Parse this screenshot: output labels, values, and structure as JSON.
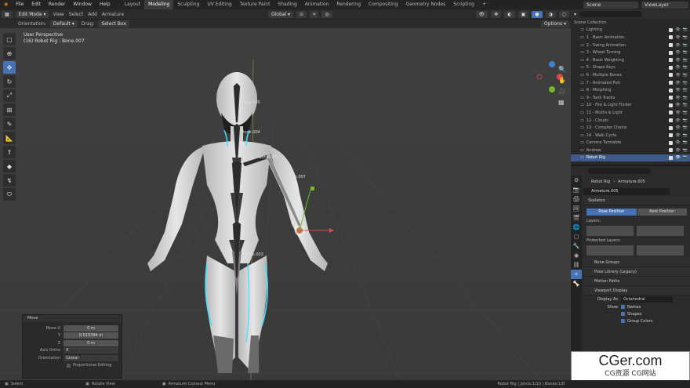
{
  "top_menu": [
    "File",
    "Edit",
    "Render",
    "Window",
    "Help"
  ],
  "workspaces": [
    "Layout",
    "Modeling",
    "Sculpting",
    "UV Editing",
    "Texture Paint",
    "Shading",
    "Animation",
    "Rendering",
    "Compositing",
    "Geometry Nodes",
    "Scripting"
  ],
  "active_workspace": "Modeling",
  "scene_name": "Scene",
  "view_layer": "ViewLayer",
  "header": {
    "mode": "Edit Mode",
    "view": "View",
    "select": "Select",
    "add": "Add",
    "armature": "Armature",
    "transform": "Global",
    "options": "Options"
  },
  "header3": {
    "orientation_label": "Orientation:",
    "orientation": "Default",
    "drag_label": "Drag:",
    "drag": "Select Box"
  },
  "viewport": {
    "view_name": "User Perspective",
    "object_info": "(16) Robot Rig : Bone.007"
  },
  "bone_labels": [
    "Bone.005",
    "Bone.004",
    "Bone.006",
    "Bone.007",
    "Bone.003"
  ],
  "move_panel": {
    "title": "Move",
    "move_x_label": "Move X",
    "x": "0 m",
    "y_label": "Y",
    "y": "0.010394 m",
    "z_label": "Z",
    "z": "0 m",
    "axis_ortho_label": "Axis Ortho",
    "axis_ortho": "X",
    "orientation_label": "Orientation",
    "orientation": "Global",
    "proportional": "Proportional Editing"
  },
  "outliner": {
    "root": "Scene Collection",
    "items": [
      {
        "label": "Lighting"
      },
      {
        "label": "1 - Basic Animation"
      },
      {
        "label": "2 - Swing Animation"
      },
      {
        "label": "3 - Wheel Turning"
      },
      {
        "label": "4 - Basic Weighting"
      },
      {
        "label": "5 - Shape Keys"
      },
      {
        "label": "6 - Multiple Bones"
      },
      {
        "label": "7 - Animated Fish"
      },
      {
        "label": "8 - Morphing"
      },
      {
        "label": "9 - Tank Tracks"
      },
      {
        "label": "10 - Fire & Light Flicker"
      },
      {
        "label": "11 - Moths & Light"
      },
      {
        "label": "12 - Clouds"
      },
      {
        "label": "13 - Complex Chains"
      },
      {
        "label": "14 - Walk Cycle"
      },
      {
        "label": "Camera Turntable"
      },
      {
        "label": "Andrew"
      },
      {
        "label": "Robot Rig"
      }
    ],
    "selected_index": 17
  },
  "properties": {
    "breadcrumb_object": "Robot Rig",
    "breadcrumb_data": "Armature.005",
    "data_name": "Armature.005",
    "skeleton": "Skeleton",
    "pose_position": "Pose Position",
    "rest_position": "Rest Position",
    "layers": "Layers:",
    "protected_layers": "Protected Layers:",
    "panels": [
      "Bone Groups",
      "Pose Library (Legacy)",
      "Motion Paths",
      "Viewport Display"
    ],
    "display_as_label": "Display As",
    "display_as": "Octahedral",
    "show_label": "Show",
    "show_names": "Names",
    "show_shapes": "Shapes",
    "show_group_colors": "Group Colors"
  },
  "status": {
    "left": "Select",
    "middle": "Rotate View",
    "right": "Armature Context Menu",
    "info": "Robot Rig | Joints:1/10 | Bones:1/8"
  },
  "watermark": {
    "title": "CGer.com",
    "subtitle": "CG资源 CG网站"
  },
  "colors": {
    "accent": "#4772b3",
    "viewport_bg": "#3d3d3d",
    "highlight_cyan": "#3fe0ff"
  }
}
